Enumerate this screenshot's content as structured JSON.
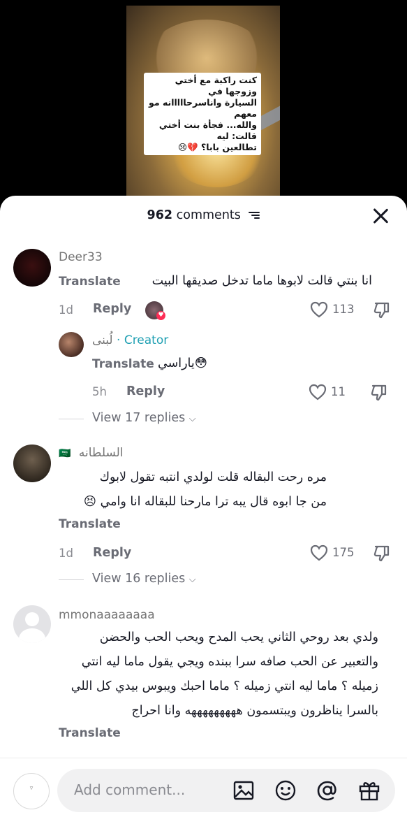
{
  "video": {
    "caption_lines": [
      "كنت راكبة مع أختي وزوجها في",
      "السيارة واناسرحااااانه مو معهم",
      "والله... فجأة بنت أختي قالت: ليه",
      "تطالعين بابا؟ 💔😢"
    ]
  },
  "header": {
    "count": "962",
    "count_label": "comments"
  },
  "comments": [
    {
      "user": "Deer33",
      "text": "انا بنتي قالت لابوها ماما تدخل صديقها البيت",
      "translate": "Translate",
      "time": "1d",
      "reply": "Reply",
      "likes": "113"
    },
    {
      "user": "لُبنى",
      "badge": "· Creator",
      "text": "ياراسي😳",
      "translate": "Translate",
      "time": "5h",
      "reply": "Reply",
      "likes": "11",
      "view_replies": "View 17 replies"
    },
    {
      "user": "السلطانه",
      "flag": "🇸🇦",
      "text_lines": [
        "مره رحت البقاله قلت لولدي انتبه تقول لابوك",
        "من جا ابوه قال يبه ترا مارحنا للبقاله انا وامي 😣"
      ],
      "translate": "Translate",
      "time": "1d",
      "reply": "Reply",
      "likes": "175",
      "view_replies": "View 16 replies"
    },
    {
      "user": "mmonaaaaaaaa",
      "text_lines": [
        "ولدي بعد روحي الثاني يحب المدح ويحب الحب والحضن",
        "والتعبير عن الحب صافه سرا ببنده ويجي يقول ماما ليه انتي",
        "زميله ؟ ماما ليه انتي زميله ؟ ماما احبك ويبوس بيدي كل اللي",
        "بالسرا يناظرون ويبتسمون هههههههههه وانا احراج"
      ],
      "translate": "Translate"
    }
  ],
  "composer": {
    "placeholder": "Add comment...",
    "avatar_glyph": "▿"
  },
  "colors": {
    "creator": "#20a0b3",
    "muted": "#6a6c75"
  }
}
